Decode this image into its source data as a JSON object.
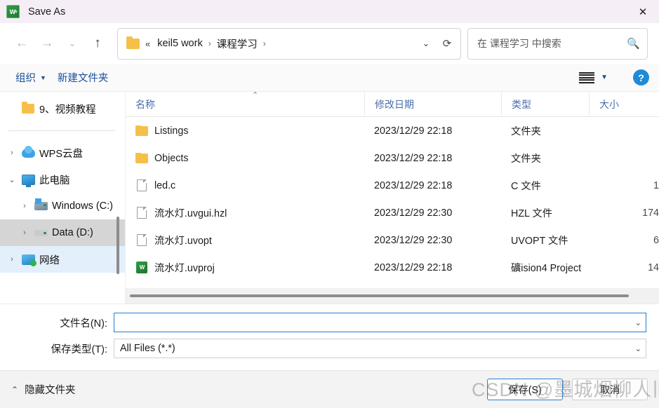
{
  "window": {
    "title": "Save As",
    "app_icon": "wps-icon",
    "close_label": "✕",
    "titlebar_bg": "#f6eef6"
  },
  "nav": {
    "back": "←",
    "forward": "→",
    "recent": "⌄",
    "up": "↑"
  },
  "address": {
    "folder_icon": "folder-icon",
    "double_chevron": "«",
    "crumbs": [
      {
        "label": "keil5 work",
        "sep": "›"
      },
      {
        "label": "课程学习",
        "sep": "›"
      }
    ],
    "dropdown": "⌄",
    "refresh": "⟳"
  },
  "search": {
    "placeholder": "在 课程学习 中搜索",
    "icon": "search-icon"
  },
  "toolbar": {
    "organize": "组织",
    "organize_caret": "▼",
    "new_folder": "新建文件夹",
    "view_caret": "▼",
    "help": "?"
  },
  "sidebar": {
    "items": [
      {
        "chev": "",
        "icon": "folder-icon",
        "label": "9、视频教程",
        "state": ""
      },
      {
        "separator": true
      },
      {
        "chev": "›",
        "icon": "cloud-icon",
        "label": "WPS云盘",
        "state": ""
      },
      {
        "chev": "⌄",
        "icon": "computer-icon",
        "label": "此电脑",
        "state": ""
      },
      {
        "chev": "›",
        "icon": "drive-windows-icon",
        "label": "Windows (C:)",
        "state": "",
        "indent": true
      },
      {
        "chev": "›",
        "icon": "drive-icon",
        "label": "Data (D:)",
        "state": "hover",
        "indent": true
      },
      {
        "chev": "›",
        "icon": "network-icon",
        "label": "网络",
        "state": "selected"
      }
    ]
  },
  "filelist": {
    "columns": [
      {
        "label": "名称",
        "key": "name"
      },
      {
        "label": "修改日期",
        "key": "date"
      },
      {
        "label": "类型",
        "key": "type"
      },
      {
        "label": "大小",
        "key": "size"
      }
    ],
    "sort_indicator": "⌃",
    "rows": [
      {
        "icon": "folder-icon",
        "name": "Listings",
        "date": "2023/12/29 22:18",
        "type": "文件夹",
        "size": ""
      },
      {
        "icon": "folder-icon",
        "name": "Objects",
        "date": "2023/12/29 22:18",
        "type": "文件夹",
        "size": ""
      },
      {
        "icon": "file-icon",
        "name": "led.c",
        "date": "2023/12/29 22:18",
        "type": "C 文件",
        "size": "1"
      },
      {
        "icon": "file-icon",
        "name": "流水灯.uvgui.hzl",
        "date": "2023/12/29 22:30",
        "type": "HZL 文件",
        "size": "174"
      },
      {
        "icon": "file-icon",
        "name": "流水灯.uvopt",
        "date": "2023/12/29 22:30",
        "type": "UVOPT 文件",
        "size": "6"
      },
      {
        "icon": "wps-icon",
        "name": "流水灯.uvproj",
        "date": "2023/12/29 22:18",
        "type": "礦ision4 Project",
        "size": "14"
      }
    ]
  },
  "form": {
    "filename_label": "文件名(N):",
    "filename_value": "",
    "filename_caret": "⌄",
    "filetype_label": "保存类型(T):",
    "filetype_value": "All Files (*.*)",
    "filetype_caret": "⌄"
  },
  "footer": {
    "hide_folders_chev": "⌃",
    "hide_folders": "隐藏文件夹",
    "save_button": "保存(S)",
    "cancel_button": "取消"
  },
  "watermark": {
    "text": "CSDN @墨城烟柳人旧人殇"
  }
}
